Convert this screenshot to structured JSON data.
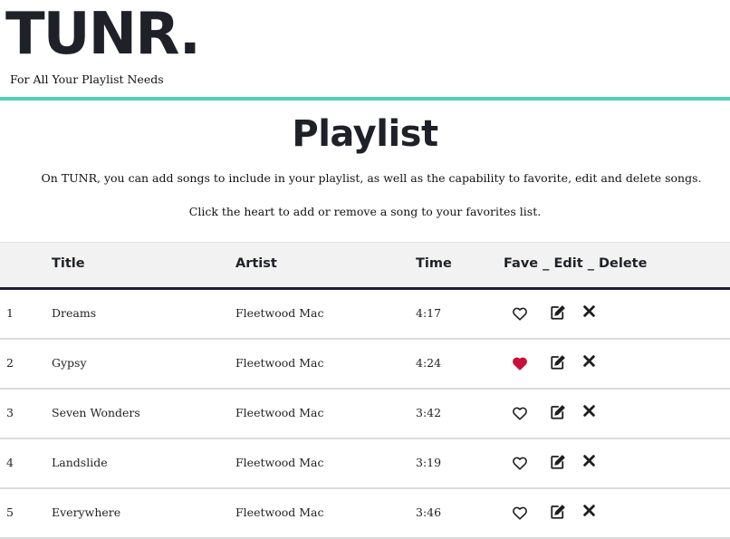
{
  "header": {
    "logo": "TUNR.",
    "tagline": "For All Your Playlist Needs"
  },
  "main": {
    "title": "Playlist",
    "description_1": "On TUNR, you can add songs to include in your playlist, as well as the capability to favorite, edit and delete songs.",
    "description_2": "Click the heart to add or remove a song to your favorites list."
  },
  "table": {
    "columns": {
      "title": "Title",
      "artist": "Artist",
      "time": "Time",
      "actions": "Fave _ Edit _ Delete"
    },
    "rows": [
      {
        "num": "1",
        "title": "Dreams",
        "artist": "Fleetwood Mac",
        "time": "4:17",
        "favorite": false
      },
      {
        "num": "2",
        "title": "Gypsy",
        "artist": "Fleetwood Mac",
        "time": "4:24",
        "favorite": true
      },
      {
        "num": "3",
        "title": "Seven Wonders",
        "artist": "Fleetwood Mac",
        "time": "3:42",
        "favorite": false
      },
      {
        "num": "4",
        "title": "Landslide",
        "artist": "Fleetwood Mac",
        "time": "3:19",
        "favorite": false
      },
      {
        "num": "5",
        "title": "Everywhere",
        "artist": "Fleetwood Mac",
        "time": "3:46",
        "favorite": false
      }
    ]
  },
  "icons": {
    "favorite": "heart-icon",
    "edit": "edit-icon",
    "delete": "close-icon"
  },
  "colors": {
    "accent": "#4fd1b8",
    "header_rule": "#1f1c3f",
    "favorite_fill": "#c8103c"
  }
}
